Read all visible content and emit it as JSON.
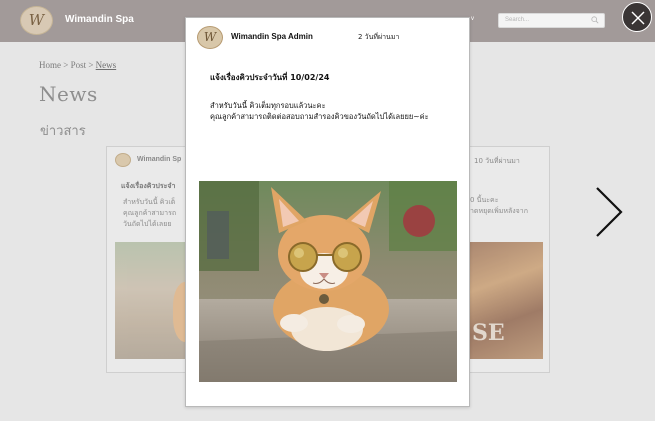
{
  "header": {
    "brand": "Wimandin Spa",
    "logo_letter": "W",
    "nav_fragment": "v",
    "search_placeholder": "Search..."
  },
  "page": {
    "breadcrumb": {
      "home": "Home",
      "sep1": ">",
      "post": "Post",
      "sep2": ">",
      "current": "News"
    },
    "title": "News",
    "subtitle": "ข่าวสาร"
  },
  "background_cards": {
    "left": {
      "author": "Wimandin Sp",
      "title": "แจ้งเรื่องคิวประจำ",
      "lines": [
        "สำหรับวันนี้ คิวเต็",
        "คุณลูกค้าสามารถ",
        "วันถัดไปได้เลยย"
      ]
    },
    "right": {
      "time": "10 วันที่ผ่านมา",
      "lines": [
        "0 นี้นะคะ",
        "าดหยุดเพิ่มหลังจาก"
      ],
      "image_text": "SE"
    }
  },
  "modal": {
    "author": "Wimandin Spa Admin",
    "time": "2 วันที่ผ่านมา",
    "title": "แจ้งเรื่องคิวประจำวันที่ 10/02/24",
    "body_lines": [
      "สำหรับวันนี้ คิวเต็มทุกรอบแล้วนะคะ",
      "คุณลูกค้าสามารถติดต่อสอบถามสำรองคิวของวันถัดไปได้เลยยย~ค่ะ"
    ],
    "photo": "cat-with-round-sunglasses"
  },
  "icons": {
    "close": "close-icon",
    "next": "chevron-right-icon",
    "search": "search-icon"
  },
  "colors": {
    "header_bg": "#a29a99",
    "page_bg": "#e6e6e6",
    "modal_bg": "#ffffff",
    "close_bg": "#3a3535"
  }
}
